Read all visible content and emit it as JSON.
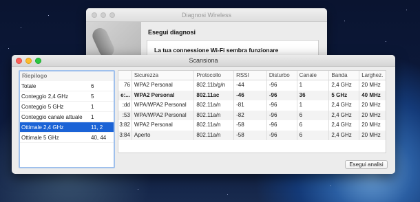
{
  "back_window": {
    "title": "Diagnosi Wireless",
    "heading": "Esegui diagnosi",
    "message": "La tua connessione Wi-Fi sembra funzionare correttamente."
  },
  "window": {
    "title": "Scansiona",
    "summary": {
      "header": "Riepilogo",
      "rows": [
        {
          "label": "Totale",
          "value": "6",
          "selected": false
        },
        {
          "label": "Conteggio 2,4 GHz",
          "value": "5",
          "selected": false
        },
        {
          "label": "Conteggio 5 GHz",
          "value": "1",
          "selected": false
        },
        {
          "label": "Conteggio canale attuale",
          "value": "1",
          "selected": false
        },
        {
          "label": "Ottimale 2,4 GHz",
          "value": "11, 2",
          "selected": true
        },
        {
          "label": "Ottimale 5 GHz",
          "value": "40, 44",
          "selected": false
        }
      ]
    },
    "table": {
      "columns": [
        "",
        "Sicurezza",
        "Protocollo",
        "RSSI",
        "Disturbo",
        "Canale",
        "Banda",
        "Larghez."
      ],
      "rows": [
        [
          "76",
          "WPA2 Personal",
          "802.11b/g/n",
          "-44",
          "-96",
          "1",
          "2,4 GHz",
          "20 MHz"
        ],
        [
          "e:...",
          "WPA2 Personal",
          "802.11ac",
          "-46",
          "-96",
          "36",
          "5 GHz",
          "40 MHz"
        ],
        [
          ":dd",
          "WPA/WPA2 Personal",
          "802.11a/n",
          "-81",
          "-96",
          "1",
          "2,4 GHz",
          "20 MHz"
        ],
        ":53 WPA/WPA2 Personal 802.11a/n -82 -96 6 2,4 GHz 20 MHz",
        [
          "3:82",
          "WPA2 Personal",
          "802.11a/n",
          "-58",
          "-96",
          "6",
          "2,4 GHz",
          "20 MHz"
        ],
        [
          "3:84",
          "Aperto",
          "802.11a/n",
          "-58",
          "-96",
          "6",
          "2,4 GHz",
          "20 MHz"
        ]
      ]
    },
    "analyze_button": "Esegui analisi"
  }
}
